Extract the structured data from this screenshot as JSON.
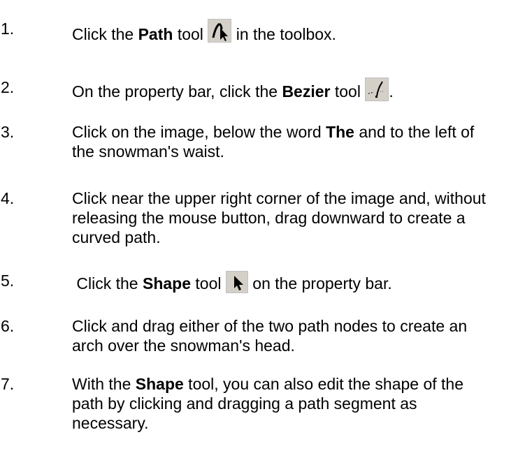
{
  "steps": [
    {
      "number": "1.",
      "parts": {
        "a": "Click the ",
        "b": "Path",
        "c": " tool ",
        "d": " in the toolbox."
      },
      "icon": "path-tool-icon"
    },
    {
      "number": "2.",
      "parts": {
        "a": "On the property bar, click the ",
        "b": "Bezier",
        "c": " tool ",
        "d": "."
      },
      "icon": "bezier-tool-icon"
    },
    {
      "number": "3.",
      "parts": {
        "a": "Click on the image, below the word ",
        "b": "The",
        "c": " and to the left of the snowman's waist."
      }
    },
    {
      "number": "4.",
      "parts": {
        "a": "Click near the upper right corner of the image and, without releasing the mouse button, drag downward to create a curved path."
      }
    },
    {
      "number": "5.",
      "parts": {
        "a": " Click the ",
        "b": "Shape",
        "c": " tool ",
        "d": " on the property bar."
      },
      "icon": "shape-tool-icon"
    },
    {
      "number": "6.",
      "parts": {
        "a": "Click and drag either of the two path nodes to create an arch over the snowman's head."
      }
    },
    {
      "number": "7.",
      "parts": {
        "a": "With the ",
        "b": "Shape",
        "c": " tool, you can also edit the shape of the path by clicking and dragging a path segment as necessary."
      }
    }
  ],
  "colors": {
    "text": "#000000",
    "background": "#ffffff",
    "icon_background": "#d4d0c8"
  }
}
